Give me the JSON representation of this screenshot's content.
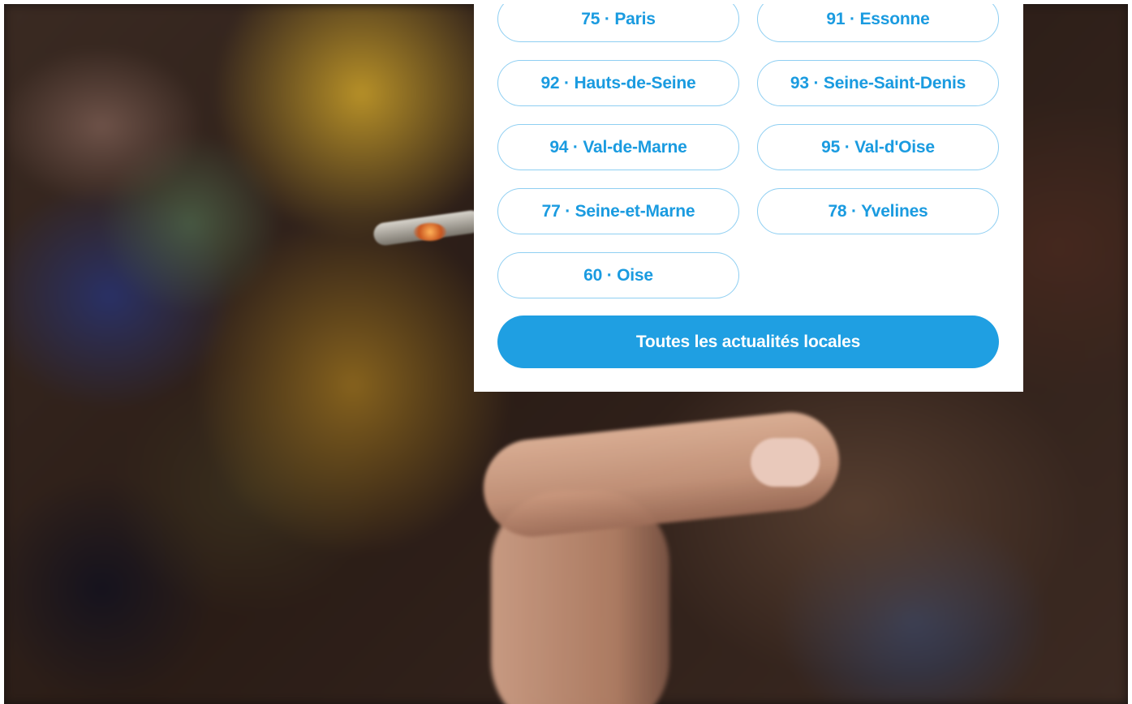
{
  "departments": [
    {
      "label": "75 · Paris"
    },
    {
      "label": "91 · Essonne"
    },
    {
      "label": "92 · Hauts-de-Seine"
    },
    {
      "label": "93 · Seine-Saint-Denis"
    },
    {
      "label": "94 · Val-de-Marne"
    },
    {
      "label": "95 · Val-d'Oise"
    },
    {
      "label": "77 · Seine-et-Marne"
    },
    {
      "label": "78 · Yvelines"
    },
    {
      "label": "60 · Oise"
    }
  ],
  "all_news_label": "Toutes les actualités locales",
  "colors": {
    "accent": "#1f9fe2",
    "button_border": "#8fcff2",
    "button_text": "#1a9be0"
  }
}
